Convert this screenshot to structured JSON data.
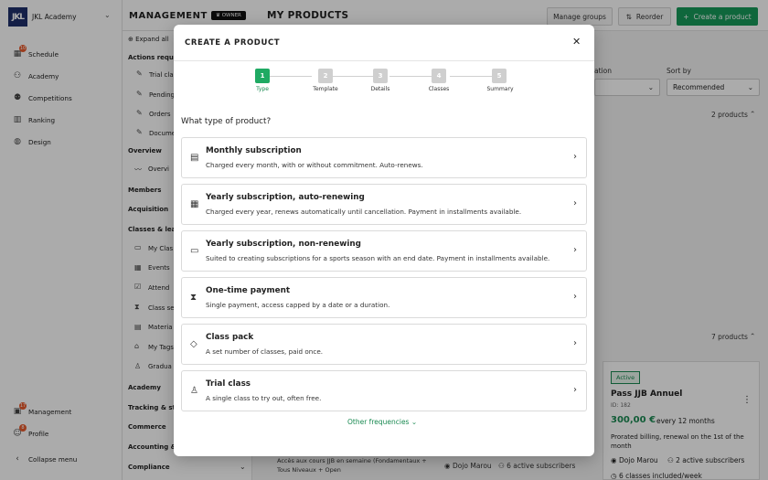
{
  "app": {
    "brand_logo": "JKL",
    "brand_name": "JKL Academy"
  },
  "leftnav": {
    "items": [
      {
        "label": "Schedule",
        "icon": "calendar-icon",
        "badge": "10"
      },
      {
        "label": "Academy",
        "icon": "users-icon",
        "badge": ""
      },
      {
        "label": "Competitions",
        "icon": "users-group-icon",
        "badge": ""
      },
      {
        "label": "Ranking",
        "icon": "building-icon",
        "badge": ""
      },
      {
        "label": "Design",
        "icon": "palette-icon",
        "badge": ""
      }
    ],
    "bottom": [
      {
        "label": "Management",
        "icon": "briefcase-icon",
        "badge": "17"
      },
      {
        "label": "Profile",
        "icon": "user-icon",
        "badge": "8"
      }
    ],
    "collapse_label": "Collapse menu"
  },
  "subnav": {
    "expand_all": "Expand all",
    "actions_required": "Actions requir",
    "trial": "Trial cla",
    "pending": "Pending",
    "orders": "Orders",
    "documents": "Docume",
    "overview_h": "Overview",
    "overview": "Overvi",
    "members": "Members",
    "acquisition": "Acquisition",
    "classes_h": "Classes & lear",
    "my_classes": "My Clas",
    "events": "Events",
    "attendance": "Attend",
    "class_series": "Class se",
    "materials": "Materia",
    "my_tags": "My Tags",
    "graduation": "Gradua",
    "academy": "Academy",
    "tracking": "Tracking & sta",
    "commerce": "Commerce",
    "accounting": "Accounting & f",
    "compliance": "Compliance"
  },
  "topbar": {
    "management": "MANAGEMENT",
    "owner_badge": "OWNER",
    "page_title": "MY PRODUCTS",
    "manage_groups": "Manage groups",
    "reorder": "Reorder",
    "create_product": "Create a product"
  },
  "background": {
    "filter_label": "ation",
    "sort_label": "Sort by",
    "sort_value": "Recommended",
    "products_count_1": "2 products",
    "products_count_2": "7 products",
    "card_status": "Active",
    "card_title": "Pass JJB Annuel",
    "card_id": "ID: 182",
    "card_price": "300,00 €",
    "card_freq": "every 12 months",
    "card_billing": "Prorated billing, renewal on the 1st of the month",
    "card_location": "Dojo Marou",
    "card_subscribers": "2 active subscribers",
    "card_classes": "6 classes included/week",
    "card2_location": "Dojo Marou",
    "card2_subscribers": "6 active subscribers",
    "card3_desc": "Accès aux cours JJB en semaine (Fondamentaux + Tous Niveaux + Open"
  },
  "modal": {
    "title": "CREATE A PRODUCT",
    "close_icon": "close-icon",
    "steps": [
      {
        "number": "1",
        "label": "Type",
        "active": true
      },
      {
        "number": "2",
        "label": "Template",
        "active": false
      },
      {
        "number": "3",
        "label": "Details",
        "active": false
      },
      {
        "number": "4",
        "label": "Classes",
        "active": false
      },
      {
        "number": "5",
        "label": "Summary",
        "active": false
      }
    ],
    "question": "What type of product?",
    "options": [
      {
        "title": "Monthly subscription",
        "description": "Charged every month, with or without commitment. Auto-renews.",
        "icon": "calendar-icon"
      },
      {
        "title": "Yearly subscription, auto-renewing",
        "description": "Charged every year, renews automatically until cancellation. Payment in installments available.",
        "icon": "calendar-grid-icon"
      },
      {
        "title": "Yearly subscription, non-renewing",
        "description": "Suited to creating subscriptions for a sports season with an end date. Payment in installments available.",
        "icon": "calendar-blank-icon"
      },
      {
        "title": "One-time payment",
        "description": "Single payment, access capped by a date or a duration.",
        "icon": "hourglass-icon"
      },
      {
        "title": "Class pack",
        "description": "A set number of classes, paid once.",
        "icon": "ticket-icon"
      },
      {
        "title": "Trial class",
        "description": "A single class to try out, often free.",
        "icon": "person-icon"
      }
    ],
    "other_frequencies": "Other frequencies"
  }
}
